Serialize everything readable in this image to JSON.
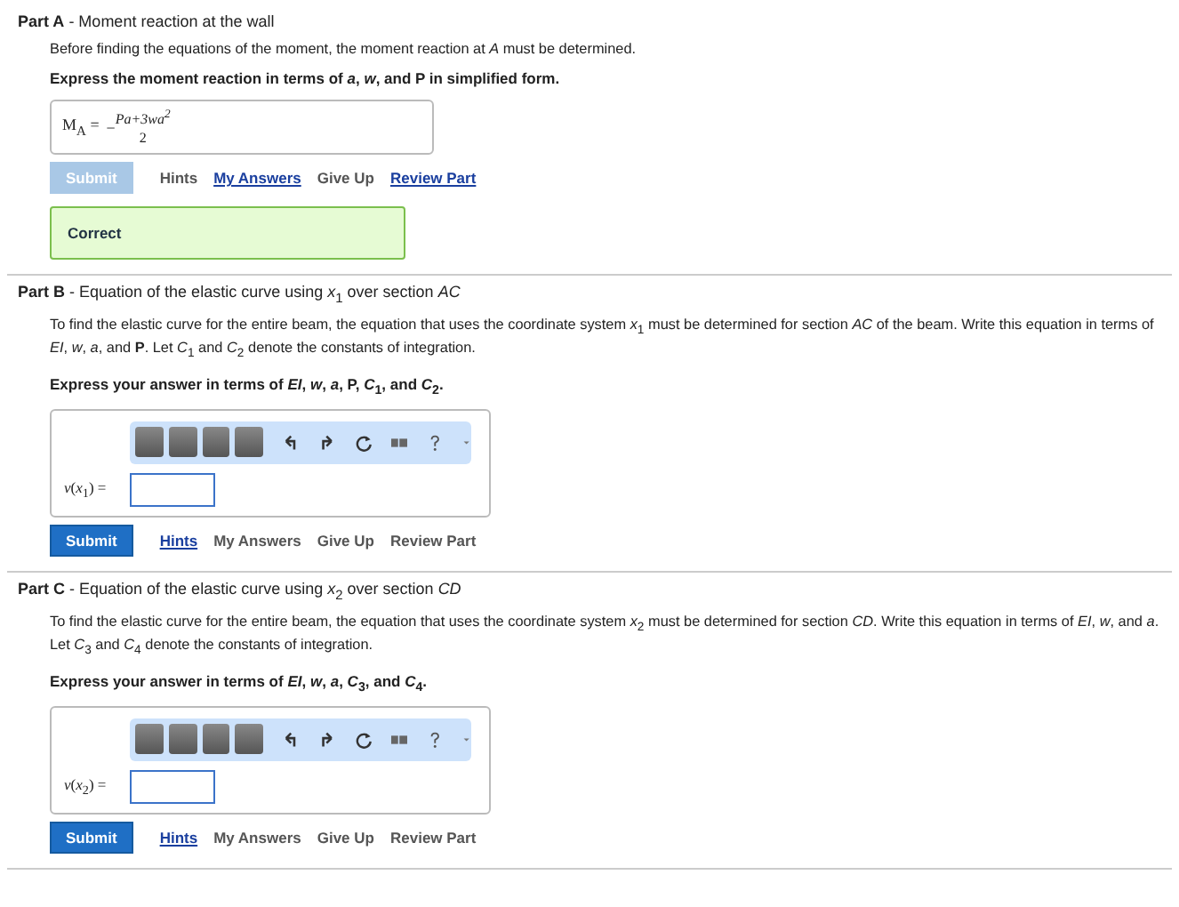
{
  "parts": [
    {
      "header": "**Part A** - Moment reaction at the wall",
      "intro": "Before finding the equations of the moment, the moment reaction at *A* must be determined.",
      "instruction": "Express the moment reaction in terms of *a*, *w*, and P in simplified form.",
      "kind": "answered",
      "answer": {
        "lhs": "M$_{A}$ =",
        "sign": "−",
        "numerator": "Pa+3wa$^{2}$",
        "denominator": "2"
      },
      "submit": {
        "label": "Submit",
        "disabled": true
      },
      "actions": [
        {
          "label": "Hints",
          "linked": false
        },
        {
          "label": "My Answers",
          "linked": true
        },
        {
          "label": "Give Up",
          "linked": false
        },
        {
          "label": "Review Part",
          "linked": true
        }
      ],
      "feedback": "Correct"
    },
    {
      "header": "**Part B** - Equation of the elastic curve using *x*$_{1}$ over section *AC*",
      "intro": "To find the elastic curve for the entire beam, the equation that uses the coordinate system *x*$_{1}$ must be determined for section *AC* of the beam. Write this equation in terms of *EI*, *w*, *a*, and **P**. Let *C*$_{1}$ and *C*$_{2}$ denote the constants of integration.",
      "instruction": "Express your answer in terms of *EI*, *w*, *a*, P, *C*$_{1}$, and *C*$_{2}$.",
      "kind": "editor",
      "field_label": "*v*(*x*$_{1}$) =",
      "submit": {
        "label": "Submit",
        "disabled": false
      },
      "actions": [
        {
          "label": "Hints",
          "linked": true
        },
        {
          "label": "My Answers",
          "linked": false
        },
        {
          "label": "Give Up",
          "linked": false
        },
        {
          "label": "Review Part",
          "linked": false
        }
      ]
    },
    {
      "header": "**Part C** - Equation of the elastic curve using *x*$_{2}$ over section *CD*",
      "intro": "To find the elastic curve for the entire beam, the equation that uses the coordinate system *x*$_{2}$ must be determined for section *CD*. Write this equation in terms of *EI*, *w*, and *a*. Let *C*$_{3}$ and *C*$_{4}$ denote the constants of integration.",
      "instruction": "Express your answer in terms of *EI*, *w*, *a*, *C*$_{3}$, and *C*$_{4}$.",
      "kind": "editor",
      "field_label": "*v*(*x*$_{2}$) =",
      "submit": {
        "label": "Submit",
        "disabled": false
      },
      "actions": [
        {
          "label": "Hints",
          "linked": true
        },
        {
          "label": "My Answers",
          "linked": false
        },
        {
          "label": "Give Up",
          "linked": false
        },
        {
          "label": "Review Part",
          "linked": false
        }
      ]
    }
  ]
}
